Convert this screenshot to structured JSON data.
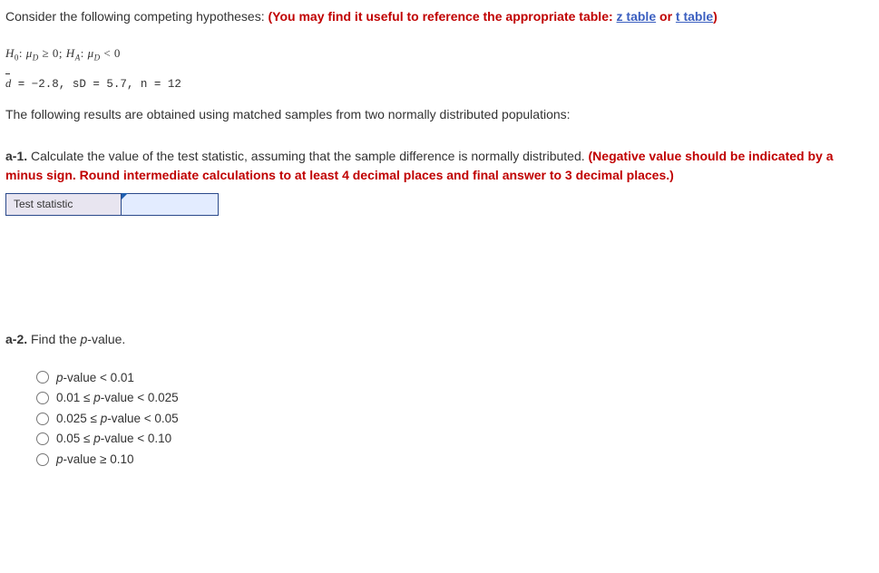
{
  "intro": {
    "lead": "Consider the following competing hypotheses: ",
    "red1": "(You may find it useful to reference the appropriate table: ",
    "link_z": "z table",
    "or": " or ",
    "link_t": "t table",
    "red2": ")"
  },
  "hypotheses": {
    "h0_label": "H",
    "h0_sub": "0",
    "h0_colon": ": ",
    "mu": "μ",
    "d_sub": "D",
    "h0_rel": " ≥ 0; ",
    "ha_label": "H",
    "ha_sub": "A",
    "ha_colon": ": ",
    "ha_rel": " < 0"
  },
  "stats": {
    "dbar": "d",
    "eq": " = ",
    "dbar_val": "−2.8",
    "comma": ", ",
    "sd_sym": "s",
    "sd_sub": "D",
    "sd_val": "5.7",
    "n_sym": "n",
    "n_val": "12"
  },
  "body": "The following results are obtained using matched samples from two normally distributed populations:",
  "a1": {
    "label": "a-1.",
    "text": " Calculate the value of the test statistic, assuming that the sample difference is normally distributed. ",
    "red": "(Negative value should be indicated by a minus sign. Round intermediate calculations to at least 4 decimal places and final answer to 3 decimal places.)"
  },
  "table": {
    "row_label": "Test statistic",
    "value": ""
  },
  "a2": {
    "label": "a-2.",
    "text_pre": " Find the ",
    "p": "p",
    "text_post": "-value."
  },
  "options": [
    {
      "p": "p",
      "text": "-value < 0.01"
    },
    {
      "pre": "0.01 ≤ ",
      "p": "p",
      "text": "-value < 0.025"
    },
    {
      "pre": "0.025 ≤ ",
      "p": "p",
      "text": "-value < 0.05"
    },
    {
      "pre": "0.05 ≤ ",
      "p": "p",
      "text": "-value < 0.10"
    },
    {
      "p": "p",
      "text": "-value ≥ 0.10"
    }
  ]
}
